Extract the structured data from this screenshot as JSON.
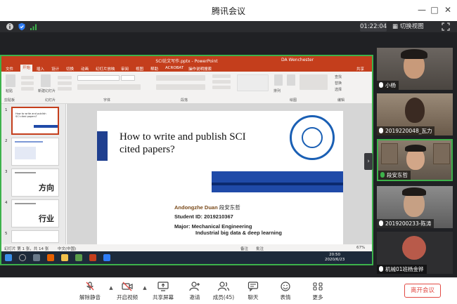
{
  "window": {
    "title": "腾讯会议",
    "min_icon": "minimize-icon",
    "max_icon": "maximize-icon",
    "close_icon": "close-icon"
  },
  "infobar": {
    "timer": "01:22:04",
    "switch_view": "切换视图",
    "icons": [
      "info-icon",
      "shield-icon",
      "signal-icon",
      "fullscreen-icon"
    ]
  },
  "ppt": {
    "window_title": "SCI论文写作.pptx - PowerPoint",
    "user": "DA Wenchester",
    "share_label": "共享",
    "menu": [
      "文件",
      "开始",
      "插入",
      "设计",
      "切换",
      "动画",
      "幻灯片放映",
      "审阅",
      "视图",
      "帮助",
      "ACROBAT",
      "操作说明搜索"
    ],
    "active_menu": "开始",
    "ribbon_groups": [
      "剪贴板",
      "幻灯片",
      "字体",
      "段落",
      "绘图",
      "编辑"
    ],
    "ribbon_items": [
      "粘贴",
      "新建幻灯片",
      "排列",
      "快速样式",
      "查找",
      "替换",
      "选择"
    ],
    "thumbnails": [
      {
        "num": "1",
        "text": "How to write and publish SCI cited papers?",
        "big": ""
      },
      {
        "num": "2",
        "text": "",
        "big": ""
      },
      {
        "num": "3",
        "text": "",
        "big": "方向"
      },
      {
        "num": "4",
        "text": "",
        "big": "行业"
      },
      {
        "num": "5",
        "text": "",
        "big": ""
      }
    ],
    "slide": {
      "title_line1": "How to write and publish SCI",
      "title_line2": "cited papers?",
      "author_label": "Andongzhe Duan",
      "author_cn": "段安东哲",
      "student_id_label": "Student ID:",
      "student_id": "2019210367",
      "major_label": "Major:",
      "major_line1": "Mechanical Engineering",
      "major_line2": "Industrial big data & deep learning"
    },
    "status": {
      "slide_info": "幻灯片 第 1 张，共 14 张",
      "lang": "中文(中国)",
      "notes": "备注",
      "comments": "批注",
      "zoom": "67%"
    },
    "taskbar": {
      "time": "20:50",
      "date": "2020/6/23"
    }
  },
  "participants": [
    {
      "name": "小杨",
      "mic": "off",
      "speaking": false
    },
    {
      "name": "2019220048_瓦力",
      "mic": "off",
      "speaking": false
    },
    {
      "name": "段安东哲",
      "mic": "on",
      "speaking": true
    },
    {
      "name": "2019200233-陈涛",
      "mic": "off",
      "speaking": false
    },
    {
      "name": "机械01班杨金铧",
      "mic": "off",
      "speaking": false
    }
  ],
  "toolbar": {
    "mute": "解除静音",
    "video": "开启视频",
    "share": "共享屏幕",
    "invite": "邀请",
    "members": "成员(45)",
    "chat": "聊天",
    "reactions": "表情",
    "more": "更多",
    "leave": "离开会议"
  },
  "colors": {
    "accent_green": "#3db24b",
    "ppt_red": "#c43e1c",
    "slide_blue": "#1f4aa8",
    "leave_red": "#e24a44"
  }
}
